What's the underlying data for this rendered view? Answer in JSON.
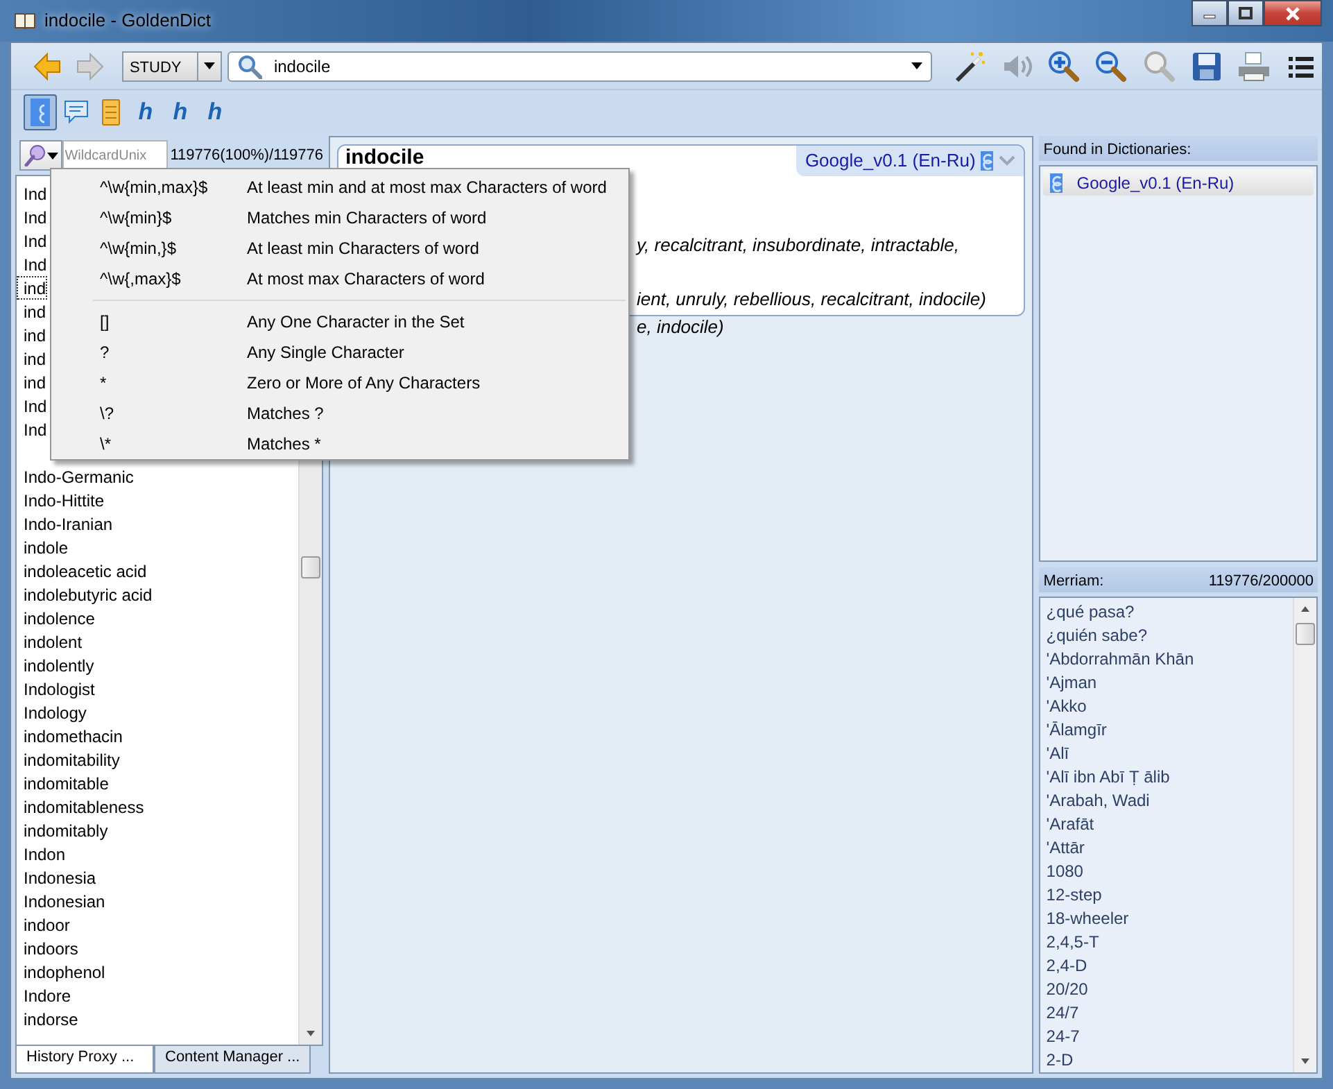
{
  "window": {
    "title": "indocile - GoldenDict"
  },
  "nav_buttons": [
    {
      "kind": "back",
      "disabled": false
    },
    {
      "kind": "forward",
      "disabled": true
    }
  ],
  "toolbar": {
    "group": "STUDY",
    "search": "indocile"
  },
  "action_buttons": [
    {
      "kind": "wand",
      "disabled": false
    },
    {
      "kind": "sound",
      "disabled": true
    },
    {
      "kind": "zoom-in",
      "disabled": false
    },
    {
      "kind": "zoom-out",
      "disabled": false
    },
    {
      "kind": "zoom-reset",
      "disabled": true
    },
    {
      "kind": "save",
      "disabled": false
    },
    {
      "kind": "print",
      "disabled": false
    },
    {
      "kind": "menu",
      "disabled": false
    }
  ],
  "dictionary_bar": [
    {
      "kind": "google",
      "selected": true
    },
    {
      "kind": "comment",
      "selected": false
    },
    {
      "kind": "note",
      "selected": false
    },
    {
      "kind": "letter",
      "label": "h",
      "selected": false
    },
    {
      "kind": "letter",
      "label": "h",
      "selected": false
    },
    {
      "kind": "letter",
      "label": "h",
      "selected": false
    }
  ],
  "word_list": {
    "placeholder": "WildcardUnix",
    "count": "119776(100%)/119776",
    "items": [
      {
        "text": "Ind",
        "selected": false
      },
      {
        "text": "Ind",
        "selected": false
      },
      {
        "text": "Ind",
        "selected": false
      },
      {
        "text": "Ind",
        "selected": false
      },
      {
        "text": "ind",
        "selected": true
      },
      {
        "text": "ind",
        "selected": false
      },
      {
        "text": "ind",
        "selected": false
      },
      {
        "text": "ind",
        "selected": false
      },
      {
        "text": "ind",
        "selected": false
      },
      {
        "text": "Ind",
        "selected": false
      },
      {
        "text": "Ind",
        "selected": false
      },
      {
        "text": "Indo-Germanic",
        "selected": false
      },
      {
        "text": "Indo-Hittite",
        "selected": false
      },
      {
        "text": "Indo-Iranian",
        "selected": false
      },
      {
        "text": "indole",
        "selected": false
      },
      {
        "text": "indoleacetic acid",
        "selected": false
      },
      {
        "text": "indolebutyric acid",
        "selected": false
      },
      {
        "text": "indolence",
        "selected": false
      },
      {
        "text": "indolent",
        "selected": false
      },
      {
        "text": "indolently",
        "selected": false
      },
      {
        "text": "Indologist",
        "selected": false
      },
      {
        "text": "Indology",
        "selected": false
      },
      {
        "text": "indomethacin",
        "selected": false
      },
      {
        "text": "indomitability",
        "selected": false
      },
      {
        "text": "indomitable",
        "selected": false
      },
      {
        "text": "indomitableness",
        "selected": false
      },
      {
        "text": "indomitably",
        "selected": false
      },
      {
        "text": "Indon",
        "selected": false
      },
      {
        "text": "Indonesia",
        "selected": false
      },
      {
        "text": "Indonesian",
        "selected": false
      },
      {
        "text": "indoor",
        "selected": false
      },
      {
        "text": "indoors",
        "selected": false
      },
      {
        "text": "indophenol",
        "selected": false
      },
      {
        "text": "Indore",
        "selected": false
      },
      {
        "text": "indorse",
        "selected": false
      }
    ],
    "tabs": [
      {
        "label": "History Proxy ...",
        "selected": true
      },
      {
        "label": "Content Manager ...",
        "selected": false
      }
    ]
  },
  "wildcard_menu": {
    "sections": [
      [
        {
          "pattern": "^\\w{min,max}$",
          "description": "At least min and at most max Characters of word"
        },
        {
          "pattern": "^\\w{min}$",
          "description": "Matches min Characters of word"
        },
        {
          "pattern": "^\\w{min,}$",
          "description": "At least min Characters of word"
        },
        {
          "pattern": "^\\w{,max}$",
          "description": "At most max Characters of word"
        }
      ],
      [
        {
          "pattern": "[]",
          "description": "Any One Character in the Set"
        },
        {
          "pattern": "?",
          "description": "Any Single Character"
        },
        {
          "pattern": "*",
          "description": "Zero or More of Any Characters"
        },
        {
          "pattern": "\\?",
          "description": "Matches ?"
        },
        {
          "pattern": "\\*",
          "description": "Matches *"
        }
      ]
    ]
  },
  "article": {
    "headword": "indocile",
    "dictionary": "Google_v0.1 (En-Ru)",
    "lines": [
      "y, recalcitrant, insubordinate, intractable,",
      "ient, unruly, rebellious, recalcitrant, indocile)",
      "e, indocile)"
    ]
  },
  "found_in_dictionaries": {
    "title": "Found in Dictionaries:",
    "items": [
      {
        "name": "Google_v0.1 (En-Ru)"
      }
    ]
  },
  "merriam": {
    "title": "Merriam:",
    "count": "119776/200000",
    "items": [
      "¿qué pasa?",
      "¿quién sabe?",
      "'Abdorrahmān Khān",
      "'Ajman",
      "'Akko",
      "'Ālamgīr",
      "'Alī",
      "'Alī ibn Abī Ṭ ālib",
      "'Arabah, Wadi",
      "'Arafāt",
      "'Attār",
      "1080",
      "12-step",
      "18-wheeler",
      "2,4,5-T",
      "2,4-D",
      "20/20",
      "24/7",
      "24-7",
      "2-D"
    ]
  }
}
